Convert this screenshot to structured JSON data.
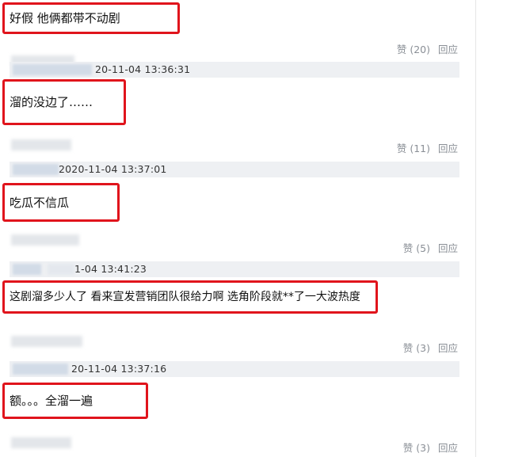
{
  "comments": [
    {
      "text": "好假 他俩都带不动剧",
      "likes": "赞 (20)",
      "reply": "回应"
    },
    {
      "time": "20-11-04 13:36:31",
      "text": "溜的没边了……",
      "likes": "赞 (11)",
      "reply": "回应"
    },
    {
      "time": "2020-11-04 13:37:01",
      "text": "吃瓜不信瓜",
      "likes": "赞 (5)",
      "reply": "回应"
    },
    {
      "time": "1-04 13:41:23",
      "text": "这剧溜多少人了 看来宣发营销团队很给力啊 选角阶段就**了一大波热度",
      "likes": "赞 (3)",
      "reply": "回应"
    },
    {
      "time": "20-11-04 13:37:16",
      "text": "额。。。全溜一遍",
      "likes": "赞 (3)",
      "reply": "回应"
    }
  ]
}
